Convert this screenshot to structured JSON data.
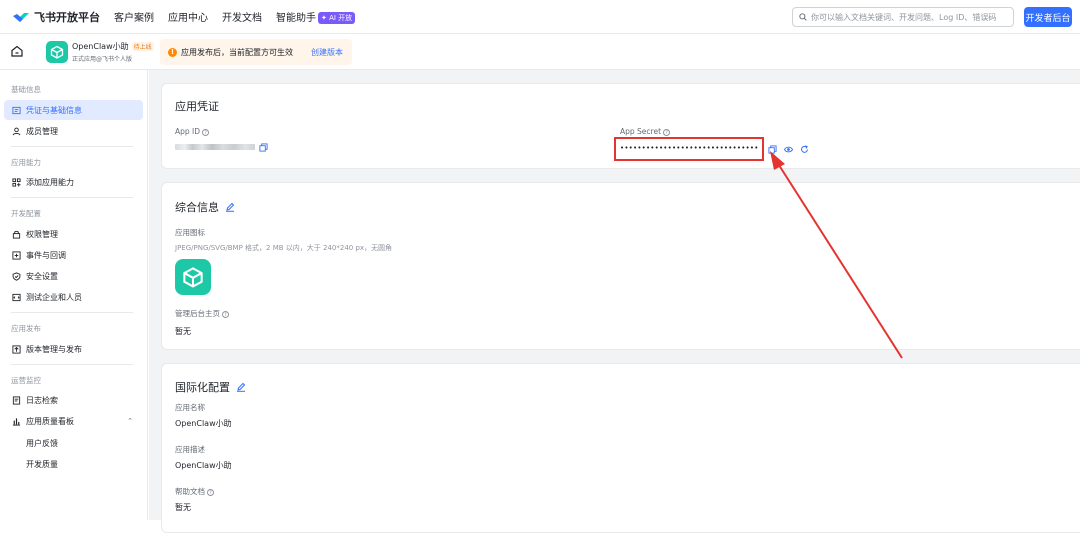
{
  "brand": {
    "name": "飞书开放平台"
  },
  "nav": {
    "items": [
      "客户案例",
      "应用中心",
      "开发文档",
      "智能助手"
    ],
    "ai_badge": "✦ AI 开放"
  },
  "search": {
    "placeholder": "你可以输入文档关键词、开发问题、Log ID、错误码"
  },
  "dev_button": "开发者后台",
  "app": {
    "name": "OpenClaw小助",
    "tag": "待上线",
    "subtitle": "正式应用@飞书个人版"
  },
  "notice": {
    "icon": "!",
    "text": "应用发布后，当前配置方可生效",
    "link": "创建版本"
  },
  "sidebar": {
    "group_basic": "基础信息",
    "item_credentials": "凭证与基础信息",
    "item_members": "成员管理",
    "group_capability": "应用能力",
    "item_add_capability": "添加应用能力",
    "group_dev": "开发配置",
    "item_permissions": "权限管理",
    "item_events": "事件与回调",
    "item_security": "安全设置",
    "item_test": "测试企业和人员",
    "group_release": "应用发布",
    "item_versions": "版本管理与发布",
    "group_ops": "运营监控",
    "item_logs": "日志检索",
    "item_quality": "应用质量看板",
    "sub_feedback": "用户反馈",
    "sub_dev_quality": "开发质量"
  },
  "credentials": {
    "title": "应用凭证",
    "app_id_label": "App ID",
    "app_secret_label": "App Secret",
    "app_secret_value": "••••••••••••••••••••••••••••••••"
  },
  "general": {
    "title": "综合信息",
    "icon_label": "应用图标",
    "icon_hint": "JPEG/PNG/SVG/BMP 格式，2 MB 以内，大于 240*240 px，无圆角",
    "homepage_label": "管理后台主页",
    "homepage_value": "暂无"
  },
  "i18n": {
    "title": "国际化配置",
    "name_label": "应用名称",
    "name_value": "OpenClaw小助",
    "desc_label": "应用描述",
    "desc_value": "OpenClaw小助",
    "help_label": "帮助文档",
    "help_value": "暂无"
  },
  "colors": {
    "accent": "#3370ff",
    "app_icon": "#1dc8a7",
    "highlight": "#e3342f"
  }
}
